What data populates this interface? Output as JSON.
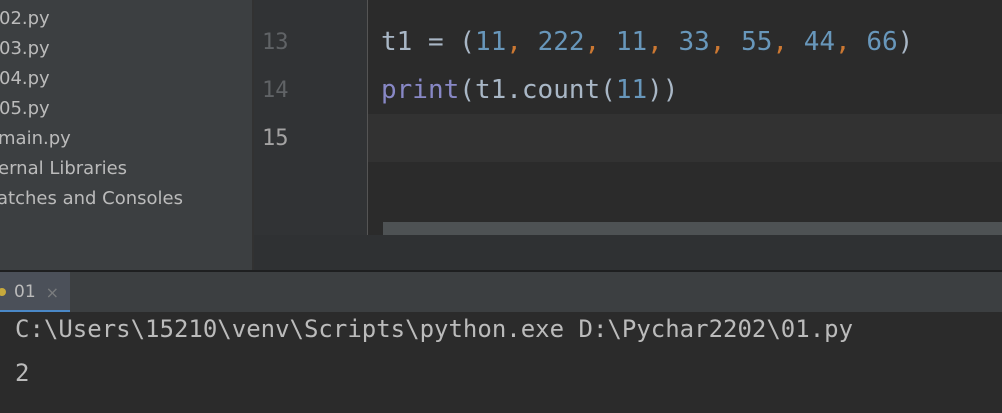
{
  "project_tree": {
    "items": [
      {
        "label": "02.py"
      },
      {
        "label": "03.py"
      },
      {
        "label": "04.py"
      },
      {
        "label": "05.py"
      },
      {
        "label": "main.py"
      },
      {
        "label": "ernal Libraries"
      },
      {
        "label": "atches and Consoles"
      }
    ]
  },
  "editor": {
    "line_numbers": [
      "13",
      "14",
      "15"
    ],
    "current_line": "15",
    "line13": {
      "var": "t1",
      "assign": " = ",
      "open": "(",
      "close": ")",
      "sep": ", ",
      "values": [
        "11",
        "222",
        "11",
        "33",
        "55",
        "44",
        "66"
      ]
    },
    "line14": {
      "func": "print",
      "open": "(",
      "call": "t1.count(",
      "arg": "11",
      "close": "))"
    }
  },
  "run_panel": {
    "tab_label": "01",
    "tab_close": "×",
    "console_lines": [
      "C:\\Users\\15210\\venv\\Scripts\\python.exe D:\\Pychar2202\\01.py",
      "2"
    ]
  },
  "colors": {
    "number": "#6897bb",
    "punctuation": "#cc7832",
    "builtin": "#8888c6",
    "identifier": "#a9b7c6",
    "tab_underline": "#4a88c7"
  }
}
